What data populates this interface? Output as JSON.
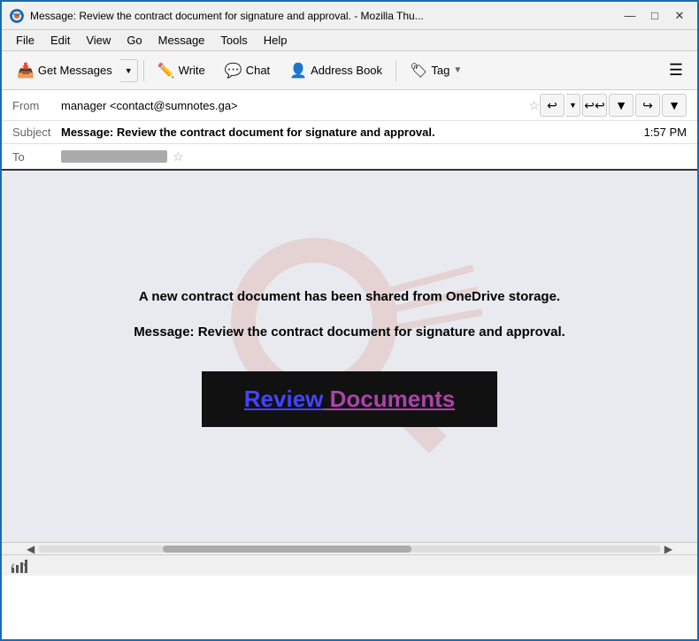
{
  "titlebar": {
    "title": "Message: Review the contract document for signature and approval. - Mozilla Thu...",
    "icon": "thunderbird"
  },
  "menubar": {
    "items": [
      "File",
      "Edit",
      "View",
      "Go",
      "Message",
      "Tools",
      "Help"
    ]
  },
  "toolbar": {
    "get_messages_label": "Get Messages",
    "write_label": "Write",
    "chat_label": "Chat",
    "address_book_label": "Address Book",
    "tag_label": "Tag"
  },
  "email": {
    "from_label": "From",
    "from_value": "manager <contact@sumnotes.ga>",
    "subject_label": "Subject",
    "subject_value": "Message: Review the contract document for signature and approval.",
    "time": "1:57 PM",
    "to_label": "To"
  },
  "body": {
    "text1": "A new contract document has been shared from OneDrive storage.",
    "text2": "Message: Review the contract document for signature and approval.",
    "btn_review": "Review",
    "btn_documents": " Documents"
  },
  "statusbar": {
    "icon": "signal-icon"
  }
}
